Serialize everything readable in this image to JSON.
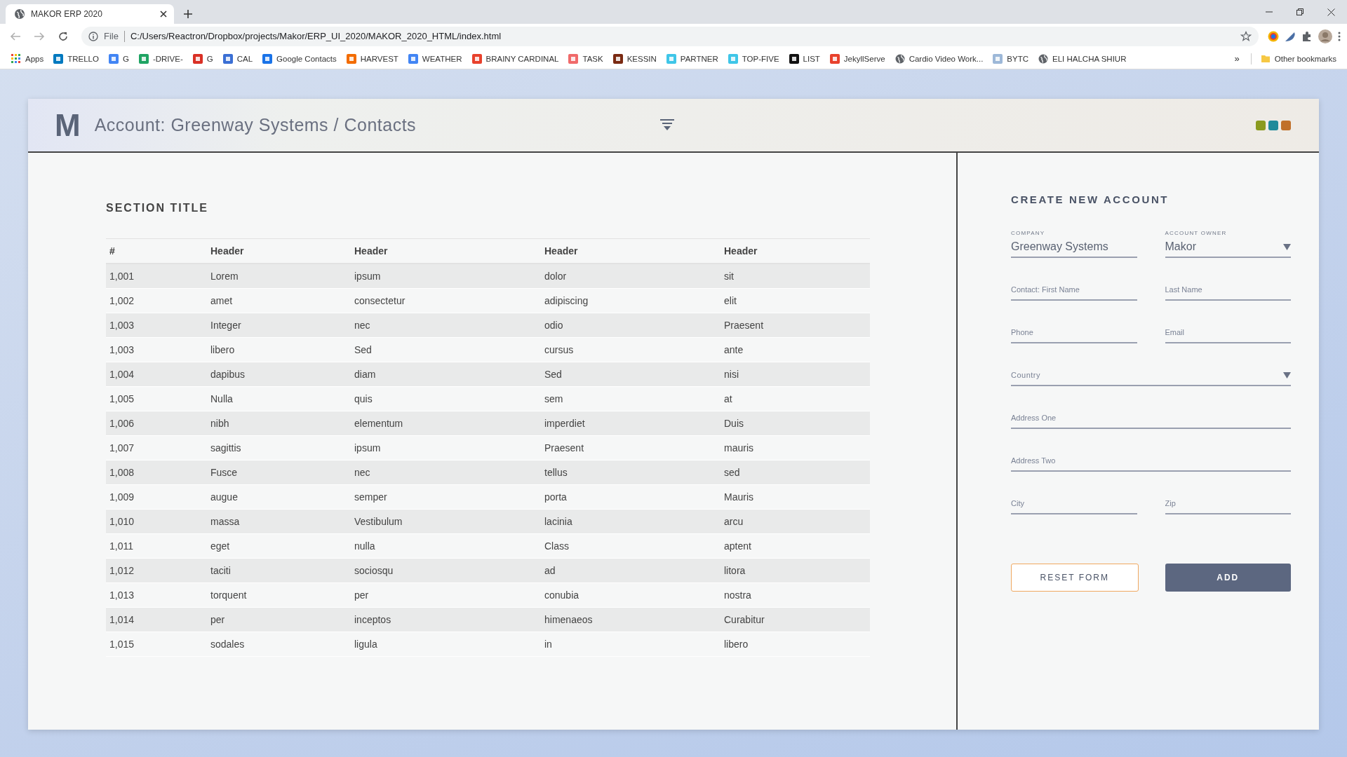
{
  "browser": {
    "tab": {
      "title": "MAKOR ERP 2020",
      "selected": true
    },
    "address": {
      "scheme": "File",
      "url": "C:/Users/Reactron/Dropbox/projects/Makor/ERP_UI_2020/MAKOR_2020_HTML/index.html"
    },
    "bookmarks": [
      {
        "kind": "apps",
        "label": "Apps"
      },
      {
        "kind": "favicon",
        "label": "TRELLO",
        "color": "#0079bf"
      },
      {
        "kind": "favicon",
        "label": "G",
        "color": "#4285f4"
      },
      {
        "kind": "favicon",
        "label": "-DRIVE-",
        "color": "#1fa463"
      },
      {
        "kind": "favicon",
        "label": "G",
        "color": "#d93025"
      },
      {
        "kind": "favicon",
        "label": "CAL",
        "color": "#3b6fd4"
      },
      {
        "kind": "favicon",
        "label": "Google Contacts",
        "color": "#1a73e8"
      },
      {
        "kind": "favicon",
        "label": "HARVEST",
        "color": "#f36c00"
      },
      {
        "kind": "favicon",
        "label": "WEATHER",
        "color": "#4285f4"
      },
      {
        "kind": "favicon",
        "label": "BRAINY CARDINAL",
        "color": "#e8412c"
      },
      {
        "kind": "favicon",
        "label": "TASK",
        "color": "#f06a6a"
      },
      {
        "kind": "favicon",
        "label": "KESSIN",
        "color": "#7a2a12"
      },
      {
        "kind": "favicon",
        "label": "PARTNER",
        "color": "#3fc6e8"
      },
      {
        "kind": "favicon",
        "label": "TOP-FIVE",
        "color": "#3fc6e8"
      },
      {
        "kind": "favicon",
        "label": "LIST",
        "color": "#111111"
      },
      {
        "kind": "favicon",
        "label": "JekyllServe",
        "color": "#e8412c"
      },
      {
        "kind": "globe",
        "label": "Cardio Video Work..."
      },
      {
        "kind": "favicon",
        "label": "BYTC",
        "color": "#9db8d8"
      },
      {
        "kind": "globe",
        "label": "ELI HALCHA SHIUR"
      }
    ],
    "overflow": "»",
    "other_bookmarks": "Other bookmarks"
  },
  "header": {
    "title": "Account: Greenway Systems / Contacts",
    "logo": "M",
    "dots": [
      {
        "color": "#8a9a1e"
      },
      {
        "color": "#1f8a9a"
      },
      {
        "color": "#c0702a"
      }
    ]
  },
  "section": {
    "title": "SECTION TITLE",
    "table": {
      "columns": [
        "#",
        "Header",
        "Header",
        "Header",
        "Header"
      ],
      "rows": [
        [
          "1,001",
          "Lorem",
          "ipsum",
          "dolor",
          "sit"
        ],
        [
          "1,002",
          "amet",
          "consectetur",
          "adipiscing",
          "elit"
        ],
        [
          "1,003",
          "Integer",
          "nec",
          "odio",
          "Praesent"
        ],
        [
          "1,003",
          "libero",
          "Sed",
          "cursus",
          "ante"
        ],
        [
          "1,004",
          "dapibus",
          "diam",
          "Sed",
          "nisi"
        ],
        [
          "1,005",
          "Nulla",
          "quis",
          "sem",
          "at"
        ],
        [
          "1,006",
          "nibh",
          "elementum",
          "imperdiet",
          "Duis"
        ],
        [
          "1,007",
          "sagittis",
          "ipsum",
          "Praesent",
          "mauris"
        ],
        [
          "1,008",
          "Fusce",
          "nec",
          "tellus",
          "sed"
        ],
        [
          "1,009",
          "augue",
          "semper",
          "porta",
          "Mauris"
        ],
        [
          "1,010",
          "massa",
          "Vestibulum",
          "lacinia",
          "arcu"
        ],
        [
          "1,011",
          "eget",
          "nulla",
          "Class",
          "aptent"
        ],
        [
          "1,012",
          "taciti",
          "sociosqu",
          "ad",
          "litora"
        ],
        [
          "1,013",
          "torquent",
          "per",
          "conubia",
          "nostra"
        ],
        [
          "1,014",
          "per",
          "inceptos",
          "himenaeos",
          "Curabitur"
        ],
        [
          "1,015",
          "sodales",
          "ligula",
          "in",
          "libero"
        ]
      ]
    }
  },
  "form": {
    "title": "CREATE NEW ACCOUNT",
    "rows": [
      [
        {
          "kind": "text",
          "label": "COMPANY",
          "value": "Greenway Systems"
        },
        {
          "kind": "select",
          "label": "ACCOUNT OWNER",
          "value": "Makor"
        }
      ],
      [
        {
          "kind": "text",
          "placeholder": "Contact: First Name"
        },
        {
          "kind": "text",
          "placeholder": "Last Name"
        }
      ],
      [
        {
          "kind": "text",
          "placeholder": "Phone"
        },
        {
          "kind": "text",
          "placeholder": "Email"
        }
      ],
      [
        {
          "kind": "select",
          "placeholder": "Country"
        }
      ],
      [
        {
          "kind": "text",
          "placeholder": "Address One"
        }
      ],
      [
        {
          "kind": "text",
          "placeholder": "Address Two"
        }
      ],
      [
        {
          "kind": "text",
          "placeholder": "City"
        },
        {
          "kind": "text",
          "placeholder": "Zip"
        }
      ]
    ],
    "buttons": [
      {
        "kind": "secondary",
        "label": "RESET FORM"
      },
      {
        "kind": "primary",
        "label": "ADD"
      }
    ]
  }
}
